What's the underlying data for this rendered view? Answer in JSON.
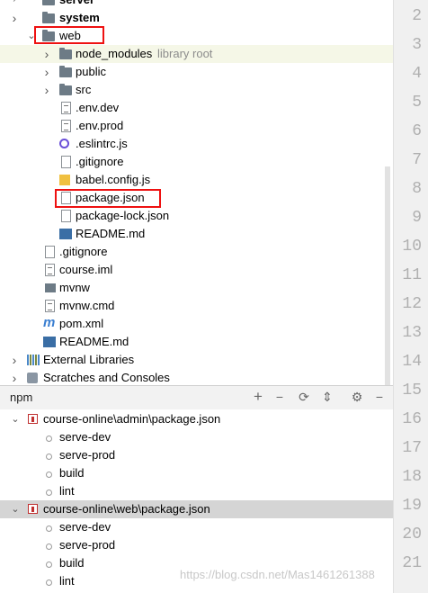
{
  "project_tree": {
    "items": [
      {
        "label": "server",
        "bold": true
      },
      {
        "label": "system",
        "bold": true
      },
      {
        "label": "web"
      },
      {
        "label": "node_modules",
        "suffix": "library root"
      },
      {
        "label": "public"
      },
      {
        "label": "src"
      },
      {
        "label": ".env.dev"
      },
      {
        "label": ".env.prod"
      },
      {
        "label": ".eslintrc.js"
      },
      {
        "label": ".gitignore"
      },
      {
        "label": "babel.config.js"
      },
      {
        "label": "package.json"
      },
      {
        "label": "package-lock.json"
      },
      {
        "label": "README.md"
      },
      {
        "label": ".gitignore"
      },
      {
        "label": "course.iml"
      },
      {
        "label": "mvnw"
      },
      {
        "label": "mvnw.cmd"
      },
      {
        "label": "pom.xml"
      },
      {
        "label": "README.md"
      },
      {
        "label": "External Libraries"
      },
      {
        "label": "Scratches and Consoles"
      }
    ]
  },
  "gutter": {
    "line_numbers": [
      "2",
      "3",
      "4",
      "5",
      "6",
      "7",
      "8",
      "9",
      "10",
      "11",
      "12",
      "13",
      "14",
      "15",
      "16",
      "17",
      "18",
      "19",
      "20",
      "21"
    ]
  },
  "npm_panel": {
    "title": "npm",
    "toolbar": {
      "add": "+",
      "remove": "−",
      "refresh": "⟳",
      "collapse": "⇕",
      "settings": "⚙",
      "minimize": "−"
    },
    "packages": [
      {
        "path": "course-online\\admin\\package.json",
        "scripts": [
          "serve-dev",
          "serve-prod",
          "build",
          "lint"
        ]
      },
      {
        "path": "course-online\\web\\package.json",
        "scripts": [
          "serve-dev",
          "serve-prod",
          "build",
          "lint"
        ]
      }
    ]
  },
  "watermark": "https://blog.csdn.net/Mas1461261388",
  "colors": {
    "highlight_box": "#e11111",
    "selection": "#d5d5d5",
    "row_highlight": "#f5f7e7"
  }
}
